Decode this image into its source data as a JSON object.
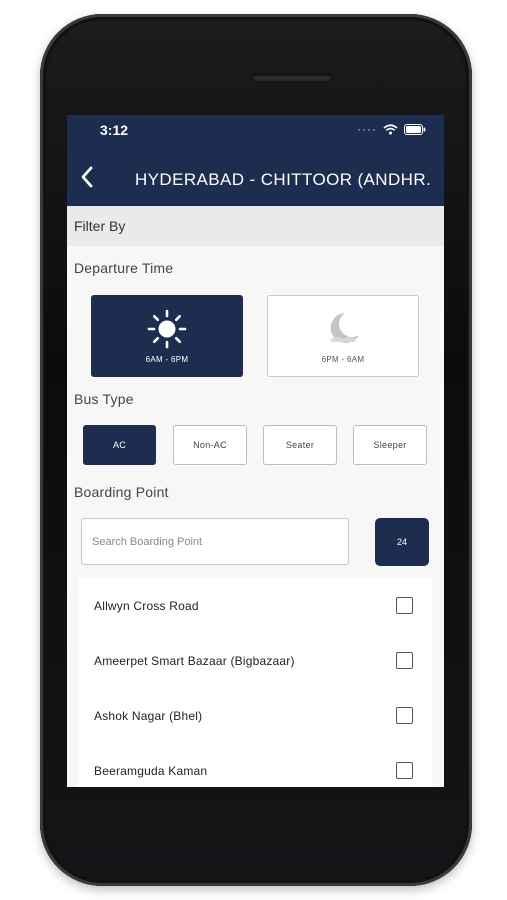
{
  "status": {
    "time": "3:12"
  },
  "header": {
    "title": "HYDERABAD - CHITTOOR (ANDHR..."
  },
  "filter": {
    "label": "Filter By"
  },
  "departure": {
    "label": "Departure Time",
    "options": [
      {
        "label": "6AM - 6PM",
        "icon": "sun-icon",
        "selected": true
      },
      {
        "label": "6PM - 6AM",
        "icon": "moon-icon",
        "selected": false
      }
    ]
  },
  "bus_type": {
    "label": "Bus Type",
    "options": [
      {
        "label": "AC",
        "selected": true
      },
      {
        "label": "Non-AC",
        "selected": false
      },
      {
        "label": "Seater",
        "selected": false
      },
      {
        "label": "Sleeper",
        "selected": false
      }
    ]
  },
  "boarding": {
    "label": "Boarding Point",
    "search_placeholder": "Search Boarding Point",
    "count": "24",
    "points": [
      {
        "name": "Allwyn Cross Road",
        "checked": false
      },
      {
        "name": "Ameerpet Smart Bazaar (Bigbazaar)",
        "checked": false
      },
      {
        "name": "Ashok Nagar (Bhel)",
        "checked": false
      },
      {
        "name": "Beeramguda Kaman",
        "checked": false
      }
    ]
  },
  "colors": {
    "primary": "#1d2d4f",
    "background": "#f7f7f7",
    "band": "#eaeaea"
  }
}
